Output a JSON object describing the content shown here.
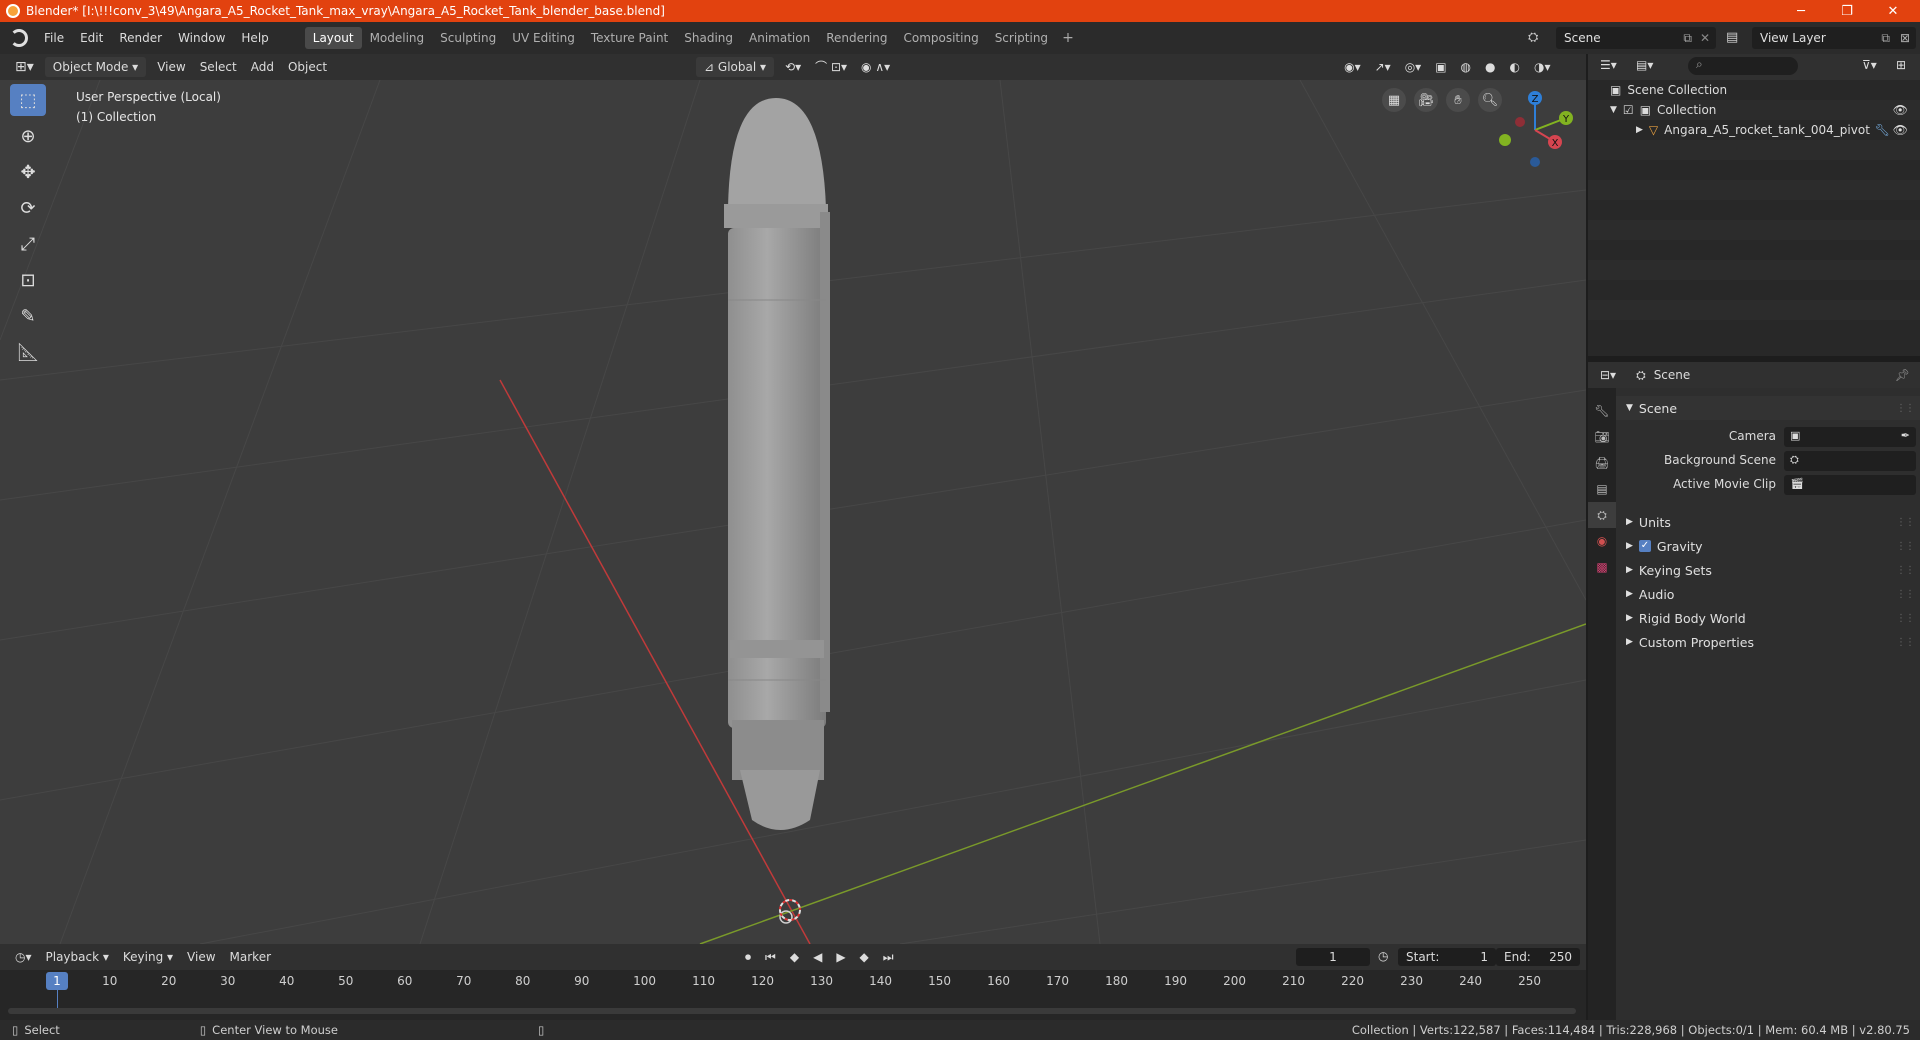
{
  "window": {
    "title": "Blender* [I:\\!!!conv_3\\49\\Angara_A5_Rocket_Tank_max_vray\\Angara_A5_Rocket_Tank_blender_base.blend]",
    "minimize": "─",
    "maximize": "❐",
    "close": "✕"
  },
  "menu": [
    "File",
    "Edit",
    "Render",
    "Window",
    "Help"
  ],
  "workspaces": [
    "Layout",
    "Modeling",
    "Sculpting",
    "UV Editing",
    "Texture Paint",
    "Shading",
    "Animation",
    "Rendering",
    "Compositing",
    "Scripting"
  ],
  "workspace_add": "+",
  "scene": {
    "name": "Scene",
    "view_layer": "View Layer"
  },
  "viewport_header": {
    "mode": "Object Mode",
    "view": "View",
    "select": "Select",
    "add": "Add",
    "object": "Object",
    "orientation": "Global"
  },
  "viewport": {
    "perspective": "User Perspective (Local)",
    "collection": "(1) Collection",
    "gizmo": {
      "z": "Z",
      "y": "Y",
      "x": "X"
    }
  },
  "timeline": {
    "playback": "Playback",
    "keying": "Keying",
    "view": "View",
    "marker": "Marker",
    "current_frame": "1",
    "start_label": "Start:",
    "start": "1",
    "end_label": "End:",
    "end": "250",
    "ticks": [
      "10",
      "20",
      "30",
      "40",
      "50",
      "60",
      "70",
      "80",
      "90",
      "100",
      "110",
      "120",
      "130",
      "140",
      "150",
      "160",
      "170",
      "180",
      "190",
      "200",
      "210",
      "220",
      "230",
      "240",
      "250"
    ],
    "cursor": "1"
  },
  "status": {
    "select": "Select",
    "center_view": "Center View to Mouse",
    "stats": "Collection | Verts:122,587 | Faces:114,484 | Tris:228,968 | Objects:0/1 | Mem: 60.4 MB | v2.80.75"
  },
  "outliner": {
    "root": "Scene Collection",
    "collection": "Collection",
    "object": "Angara_A5_rocket_tank_004_pivot"
  },
  "properties": {
    "header": "Scene",
    "panel": "Scene",
    "camera_label": "Camera",
    "background_label": "Background Scene",
    "movie_clip_label": "Active Movie Clip",
    "sections": [
      "Units",
      "Gravity",
      "Keying Sets",
      "Audio",
      "Rigid Body World",
      "Custom Properties"
    ]
  },
  "colors": {
    "title_bar": "#e2420f",
    "active_tool": "#5680c2",
    "axis_x": "#c03a3a",
    "axis_y": "#7a9a2a",
    "gizmo_z": "#2e7fd8",
    "gizmo_y": "#82b321",
    "gizmo_x": "#d64550"
  }
}
